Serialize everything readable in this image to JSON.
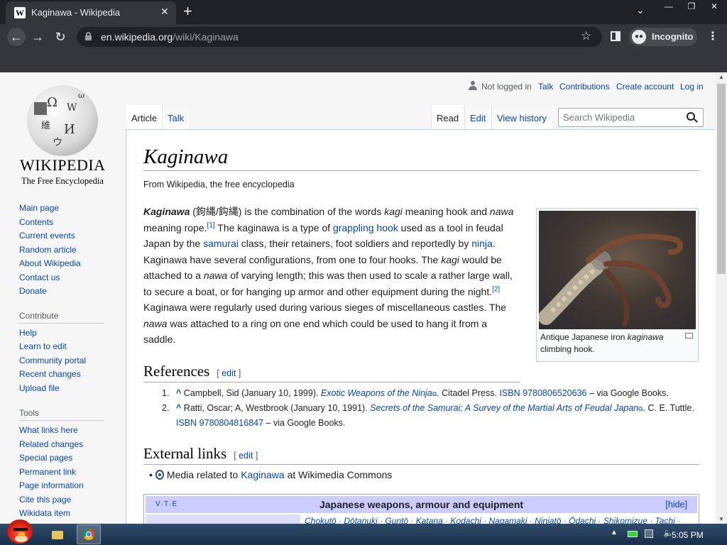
{
  "browser": {
    "tab_title": "Kaginawa - Wikipedia",
    "tab_favicon": "W",
    "new_tab_glyph": "+",
    "close_glyph": "✕",
    "url_host": "en.wikipedia.org",
    "url_path": "/wiki/Kaginawa",
    "incognito_label": "Incognito",
    "window_buttons": {
      "minimize": "—",
      "maximize": "❐",
      "close": "✕"
    },
    "nav_glyphs": {
      "back": "←",
      "forward": "→",
      "reload": "↻",
      "star": "☆",
      "menu": "⋮",
      "tab_search": "⌄"
    }
  },
  "wiki": {
    "logo": {
      "wordmark": "WIKIPEDIA",
      "tagline": "The Free Encyclopedia"
    },
    "personal": {
      "not_logged_in": "Not logged in",
      "talk": "Talk",
      "contributions": "Contributions",
      "create_account": "Create account",
      "log_in": "Log in"
    },
    "tabs": {
      "article": "Article",
      "talk": "Talk",
      "read": "Read",
      "edit": "Edit",
      "history": "View history"
    },
    "search_placeholder": "Search Wikipedia",
    "sidebar": {
      "main": [
        "Main page",
        "Contents",
        "Current events",
        "Random article",
        "About Wikipedia",
        "Contact us",
        "Donate"
      ],
      "contribute_heading": "Contribute",
      "contribute": [
        "Help",
        "Learn to edit",
        "Community portal",
        "Recent changes",
        "Upload file"
      ],
      "tools_heading": "Tools",
      "tools": [
        "What links here",
        "Related changes",
        "Special pages",
        "Permanent link",
        "Page information",
        "Cite this page",
        "Wikidata item"
      ]
    },
    "article": {
      "title": "Kaginawa",
      "site_sub": "From Wikipedia, the free encyclopedia",
      "lead": {
        "term": "Kaginawa",
        "kanji": " (鉤縄/鈎縄) is the combination of the words ",
        "kagi": "kagi",
        "t1": " meaning hook and ",
        "nawa": "nawa",
        "t2": " meaning rope.",
        "sup1": "[1]",
        "t3": " The kaginawa is a type of ",
        "link_grappling": "grappling hook",
        "t4": " used as a tool in feudal Japan by the ",
        "link_samurai": "samurai",
        "t5": " class, their retainers, foot soldiers and reportedly by ",
        "link_ninja": "ninja",
        "t6": ". Kaginawa have several configurations, from one to four hooks. The ",
        "kagi2": "kagi",
        "t7": " would be attached to a ",
        "nawa2": "nawa",
        "t8": " of varying length; this was then used to scale a rather large wall, to secure a boat, or for hanging up armor and other equipment during the night.",
        "sup2": "[2]",
        "t9": " Kaginawa were regularly used during various sieges of miscellaneous castles. The ",
        "nawa3": "nawa",
        "t10": " was attached to a ring on one end which could be used to hang it from a saddle."
      },
      "thumb_caption_pre": "Antique Japanese iron ",
      "thumb_caption_em": "kaginawa",
      "thumb_caption_post": " climbing hook.",
      "references_heading": "References",
      "edit_open": "[ ",
      "edit_label": "edit",
      "edit_close": " ]",
      "refs": [
        {
          "num": "1.",
          "caret": "^",
          "pre": " Campbell, Sid (January 10, 1999). ",
          "title": "Exotic Weapons of the Ninja",
          "mid": ". Citadel Press. ",
          "isbn_label": "ISBN",
          "isbn": "9780806520636",
          "post": " – via Google Books."
        },
        {
          "num": "2.",
          "caret": "^",
          "pre": " Ratti, Oscar; A, Westbrook (January 10, 1991). ",
          "title": "Secrets of the Samurai; A Survey of the Martial Arts of Feudal Japan",
          "mid": ". C. E. Tuttle. ",
          "isbn_label": "ISBN",
          "isbn": "9780804816847",
          "post": " – via Google Books."
        }
      ],
      "external_heading": "External links",
      "commons_pre": "Media related to ",
      "commons_link": "Kaginawa",
      "commons_post": " at Wikimedia Commons",
      "navbox": {
        "vte": "V·T·E",
        "title": "Japanese weapons, armour and equipment",
        "hide": "[hide]",
        "list": "Chokutō · Dōtanuki · Guntō · Katana · Kodachi · Nagamaki · Ninjatō · Ōdachi · Shikomizue · Tachi ·"
      }
    }
  },
  "taskbar": {
    "clock": "5:05 PM",
    "tray_up": "▲",
    "volume_glyph": "🔈"
  }
}
